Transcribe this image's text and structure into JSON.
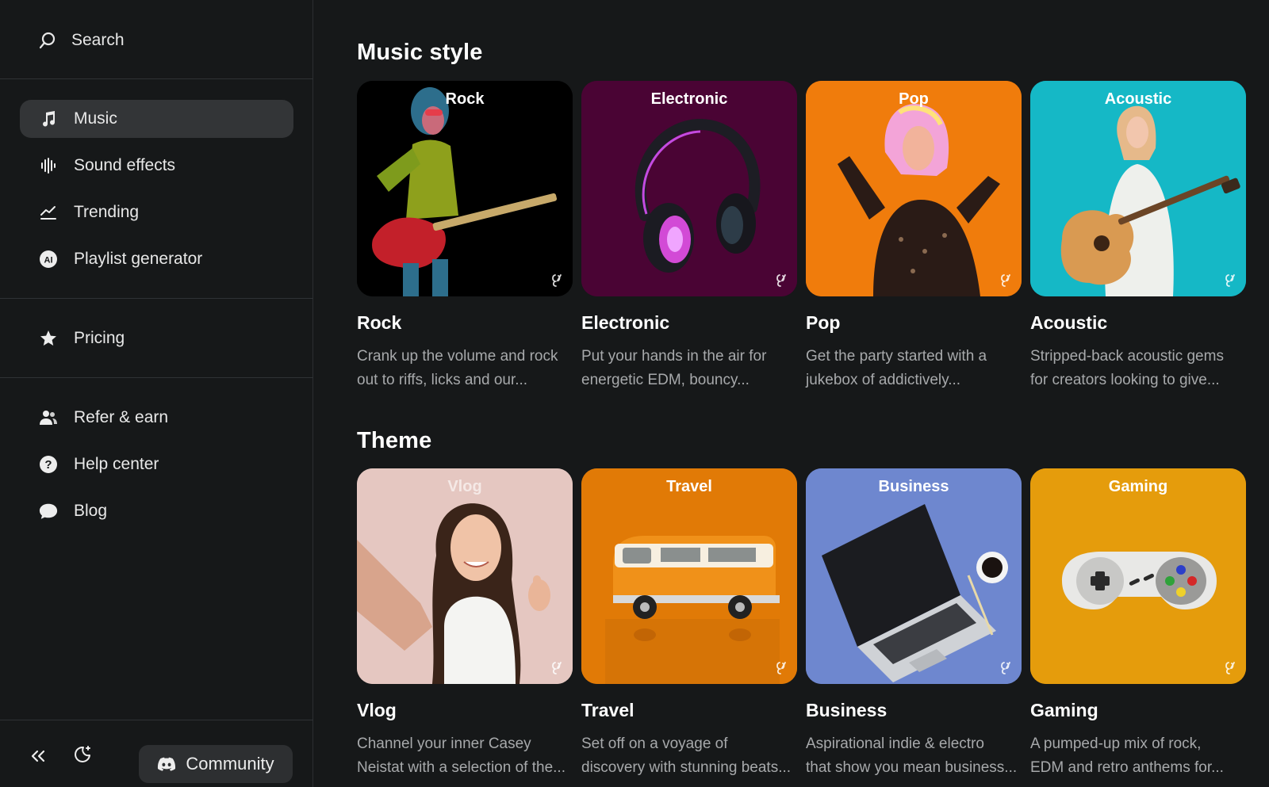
{
  "sidebar": {
    "search_label": "Search",
    "nav": [
      {
        "label": "Music",
        "icon": "music-note-icon",
        "active": true
      },
      {
        "label": "Sound effects",
        "icon": "waveform-icon"
      },
      {
        "label": "Trending",
        "icon": "trending-icon"
      },
      {
        "label": "Playlist generator",
        "icon": "ai-icon",
        "icon_text": "AI"
      }
    ],
    "pricing": {
      "label": "Pricing",
      "icon": "star-icon"
    },
    "help": [
      {
        "label": "Refer & earn",
        "icon": "users-icon"
      },
      {
        "label": "Help center",
        "icon": "help-icon",
        "icon_text": "?"
      },
      {
        "label": "Blog",
        "icon": "chat-bubble-icon"
      }
    ],
    "community_label": "Community"
  },
  "sections": [
    {
      "title": "Music style",
      "cards": [
        {
          "thumb_label": "Rock",
          "title": "Rock",
          "desc_line1": "Crank up the volume and rock",
          "desc_line2": "out to riffs, licks and our...",
          "bg": "#000000"
        },
        {
          "thumb_label": "Electronic",
          "title": "Electronic",
          "desc_line1": "Put your hands in the air for",
          "desc_line2": "energetic EDM, bouncy...",
          "bg": "#4a0434"
        },
        {
          "thumb_label": "Pop",
          "title": "Pop",
          "desc_line1": "Get the party started with a",
          "desc_line2": "jukebox of addictively...",
          "bg": "#f07c0c"
        },
        {
          "thumb_label": "Acoustic",
          "title": "Acoustic",
          "desc_line1": "Stripped-back acoustic gems",
          "desc_line2": "for creators looking to give...",
          "bg": "#15b8c6"
        }
      ]
    },
    {
      "title": "Theme",
      "cards": [
        {
          "thumb_label": "Vlog",
          "title": "Vlog",
          "desc_line1": "Channel your inner Casey",
          "desc_line2": "Neistat with a selection of the...",
          "bg": "#e5c7c1"
        },
        {
          "thumb_label": "Travel",
          "title": "Travel",
          "desc_line1": "Set off on a voyage of",
          "desc_line2": "discovery with stunning beats...",
          "bg": "#e17a06"
        },
        {
          "thumb_label": "Business",
          "title": "Business",
          "desc_line1": "Aspirational indie & electro",
          "desc_line2": "that show you mean business...",
          "bg": "#6e87cf"
        },
        {
          "thumb_label": "Gaming",
          "title": "Gaming",
          "desc_line1": "A pumped-up mix of rock,",
          "desc_line2": "EDM and retro anthems for...",
          "bg": "#e59c0c"
        }
      ]
    }
  ]
}
